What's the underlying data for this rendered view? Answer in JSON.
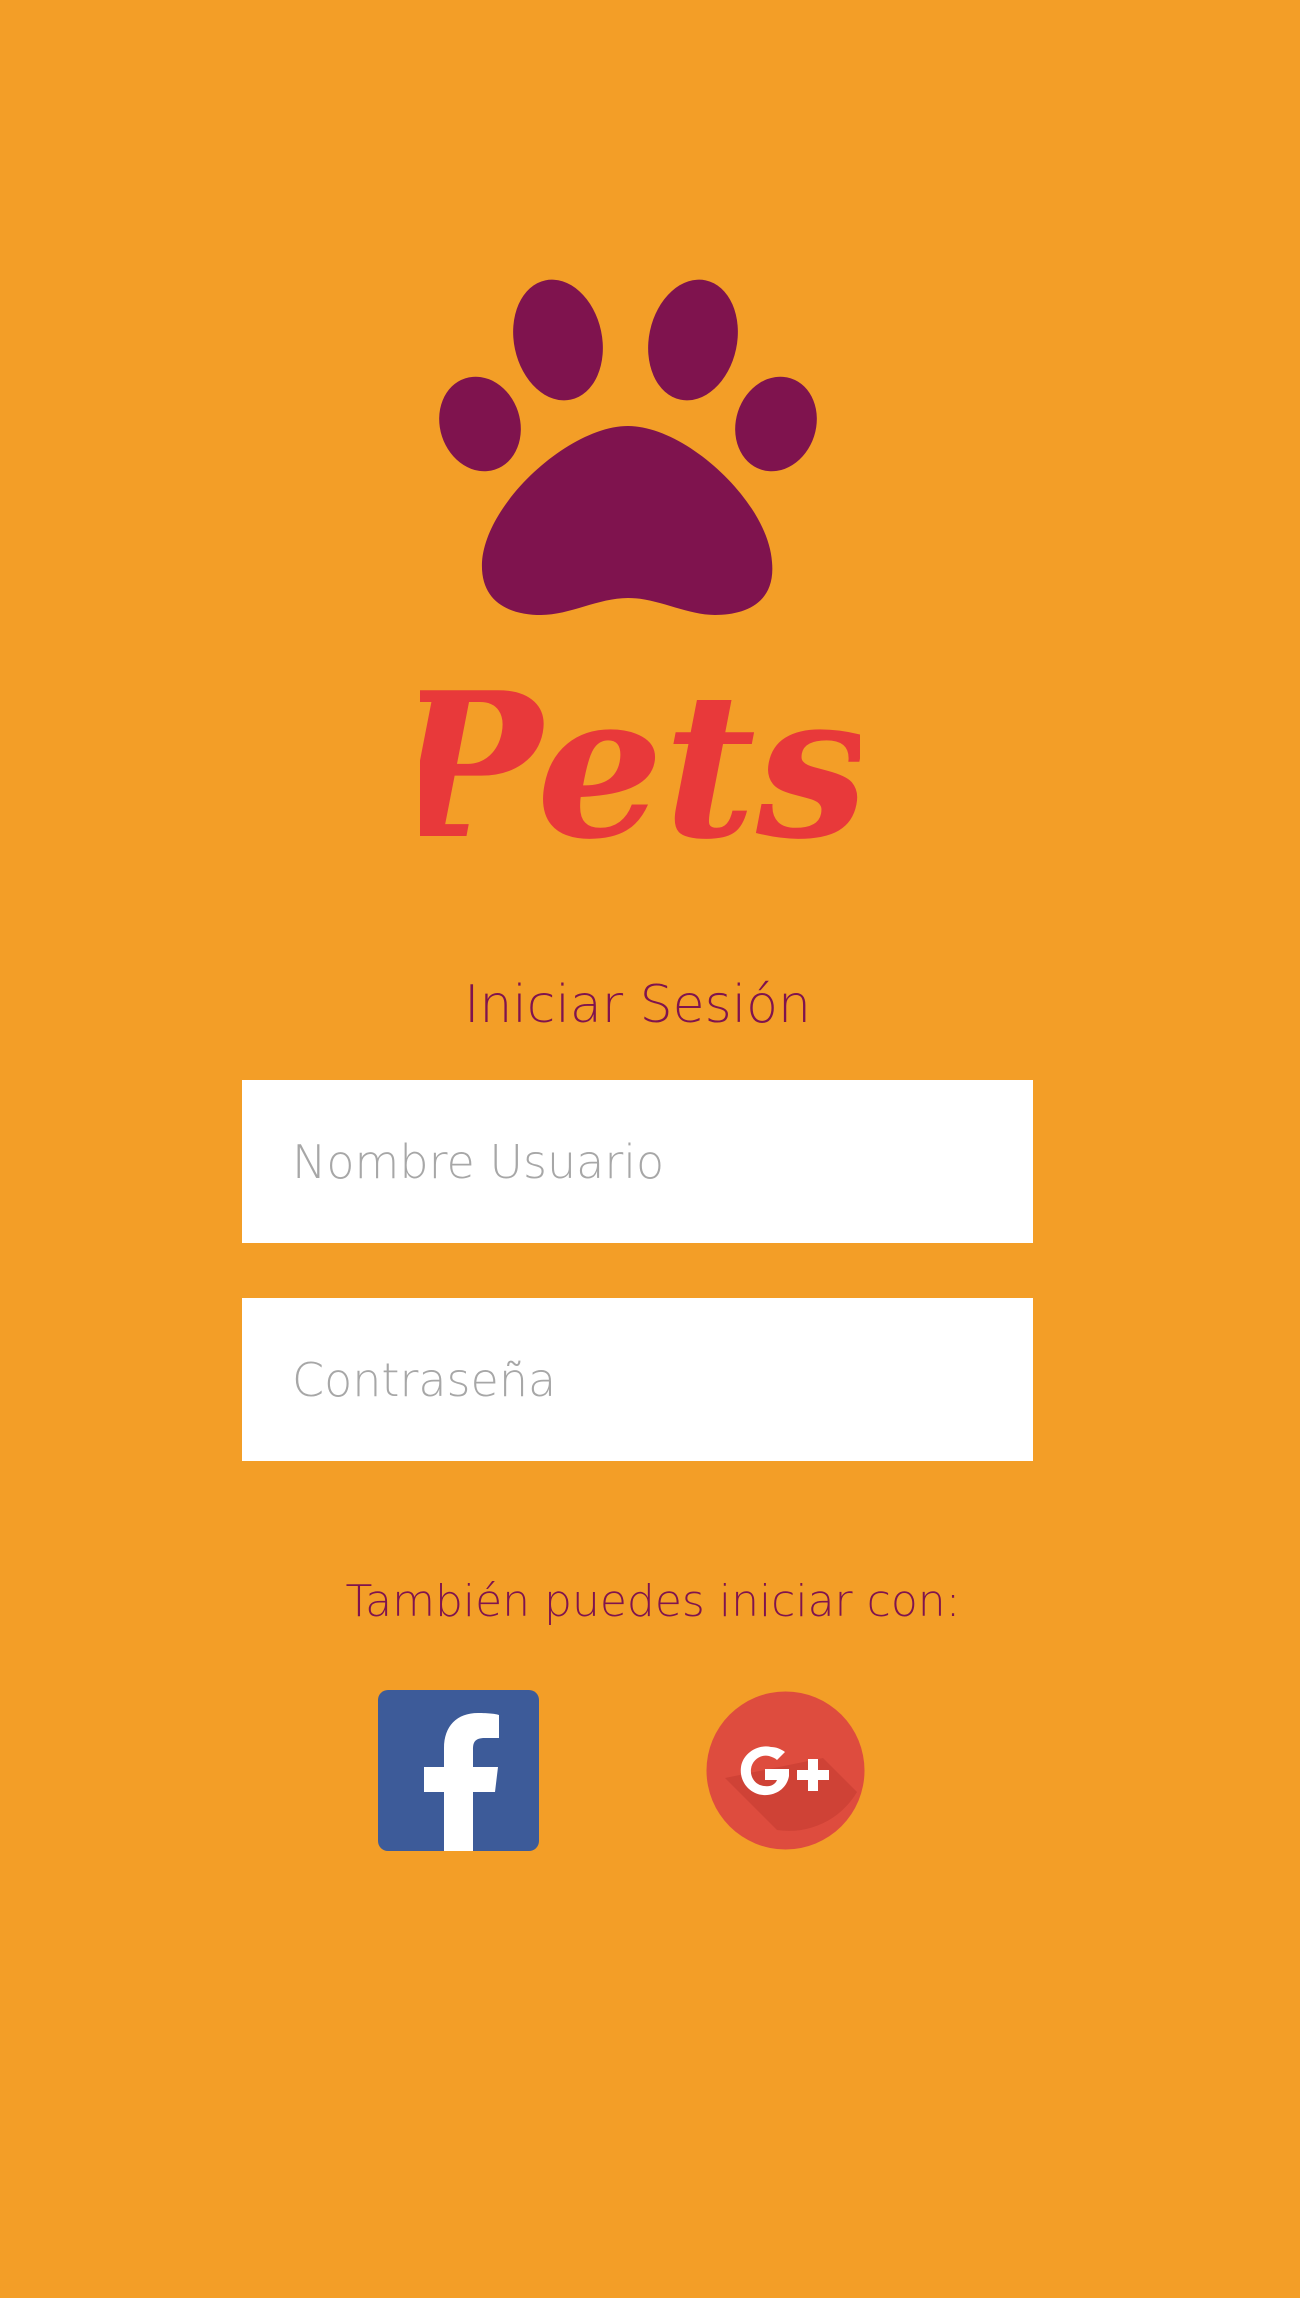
{
  "brand": {
    "name": "Pets",
    "colors": {
      "background": "#F39E27",
      "paw": "#7F134E",
      "wordmark": "#E8393A",
      "heading_text": "#7F134E",
      "facebook": "#3D5B99",
      "google_plus": "#DE4C3E"
    }
  },
  "login": {
    "title": "Iniciar Sesión",
    "username": {
      "placeholder": "Nombre Usuario",
      "value": ""
    },
    "password": {
      "placeholder": "Contraseña",
      "value": ""
    }
  },
  "social": {
    "label": "También puedes iniciar con:",
    "providers": [
      {
        "id": "facebook",
        "icon": "facebook-icon"
      },
      {
        "id": "google_plus",
        "icon": "google-plus-icon"
      }
    ]
  }
}
